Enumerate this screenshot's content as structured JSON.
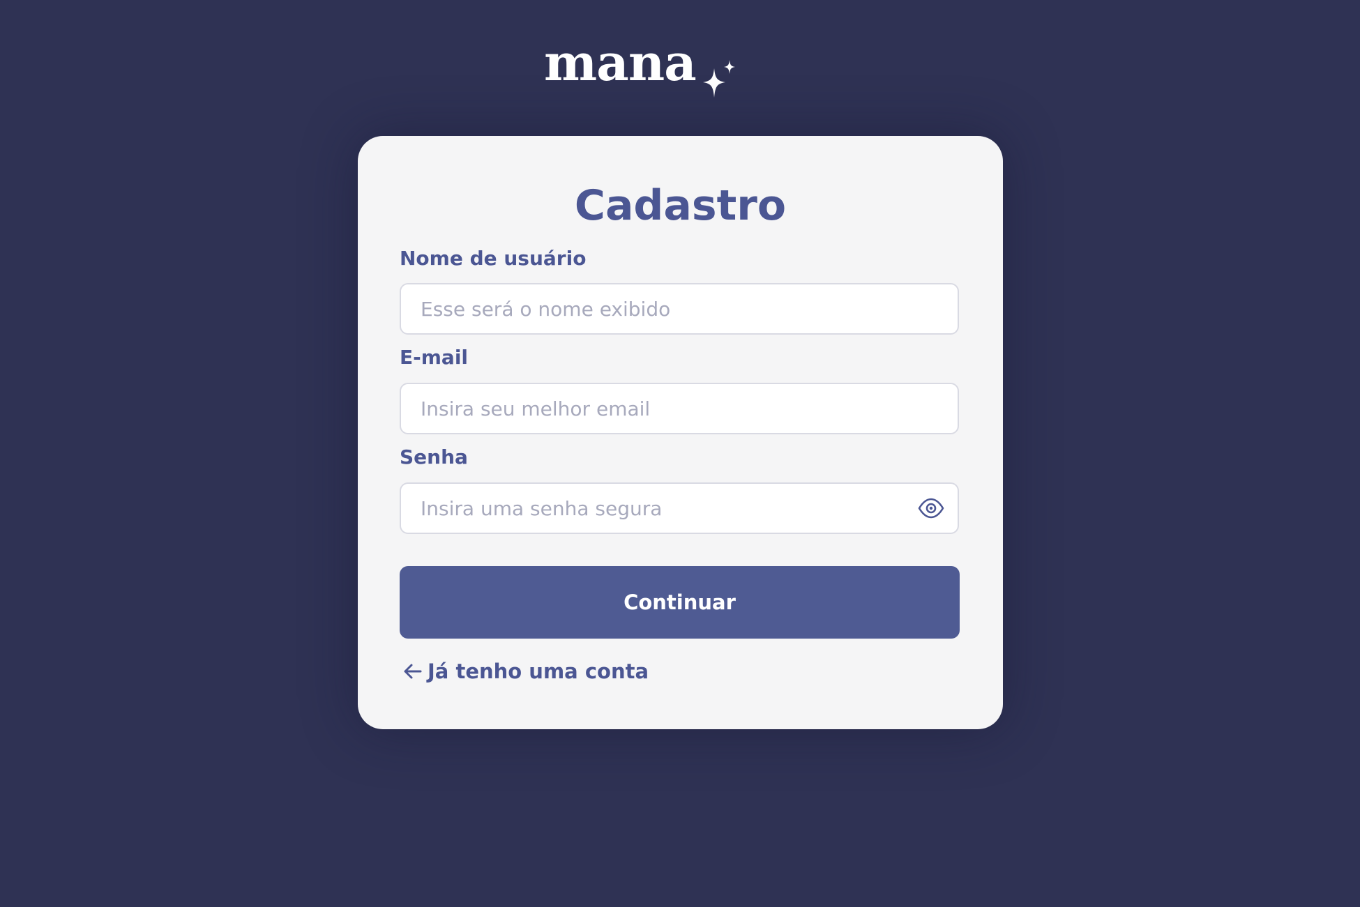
{
  "brand": {
    "name": "mana",
    "logo_icon": "sparkle-icon",
    "text_color": "#ffffff"
  },
  "colors": {
    "background": "#2f3254",
    "card": "#f5f5f6",
    "accent": "#4b5693",
    "button": "#4f5b93"
  },
  "form": {
    "title": "Cadastro",
    "username": {
      "label": "Nome de usuário",
      "placeholder": "Esse será o nome exibido",
      "value": ""
    },
    "email": {
      "label": "E-mail",
      "placeholder": "Insira seu melhor email",
      "value": ""
    },
    "password": {
      "label": "Senha",
      "placeholder": "Insira uma senha segura",
      "value": "",
      "toggle_icon": "eye-icon"
    },
    "submit_label": "Continuar",
    "back_link": {
      "label": "Já tenho uma conta",
      "icon": "arrow-left-icon"
    }
  }
}
